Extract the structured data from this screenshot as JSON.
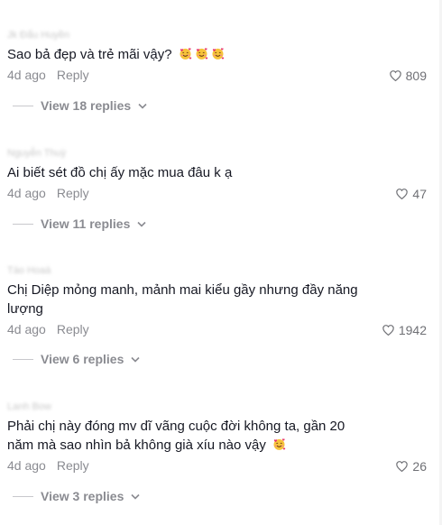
{
  "comments": [
    {
      "author": "Jk Đẩu Huyền",
      "text": "Sao bả đẹp và trẻ mãi vậy?",
      "emoji_count": 3,
      "time": "4d ago",
      "reply_label": "Reply",
      "likes": "809",
      "view_replies": "View 18 replies"
    },
    {
      "author": "Nguyễn Thuỳ",
      "text": "Ai biết sét đồ chị ấy mặc mua đâu k ạ",
      "emoji_count": 0,
      "time": "4d ago",
      "reply_label": "Reply",
      "likes": "47",
      "view_replies": "View 11 replies"
    },
    {
      "author": "Táo Hoaà",
      "text": "Chị Diệp mỏng manh, mảnh mai kiểu gầy nhưng đầy năng lượng",
      "emoji_count": 0,
      "time": "4d ago",
      "reply_label": "Reply",
      "likes": "1942",
      "view_replies": "View 6 replies"
    },
    {
      "author": "Lanh Bow",
      "text": "Phải chị này đóng mv dĩ vãng cuộc đời không ta, gần 20 năm mà sao nhìn bả không già xíu nào vậy",
      "emoji_count": 1,
      "time": "4d ago",
      "reply_label": "Reply",
      "likes": "26",
      "view_replies": "View 3 replies"
    }
  ],
  "icons": {
    "emoji": "face-with-hearts",
    "like": "heart-outline-icon",
    "expand": "chevron-down-icon"
  },
  "colors": {
    "text": "#161823",
    "secondary": "#8a8b91"
  }
}
